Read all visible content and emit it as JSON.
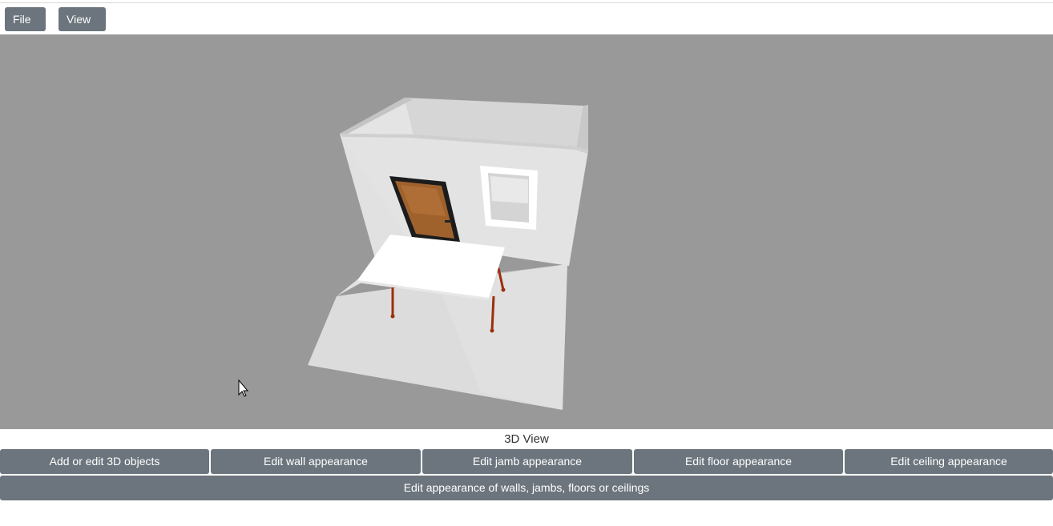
{
  "menubar": {
    "file_label": "File",
    "view_label": "View"
  },
  "viewport": {
    "background": "#999999",
    "caption": "3D View"
  },
  "actions": {
    "row1": [
      "Add or edit 3D objects",
      "Edit wall appearance",
      "Edit jamb appearance",
      "Edit floor appearance",
      "Edit ceiling appearance"
    ],
    "combined": "Edit appearance of walls, jambs, floors or ceilings"
  },
  "colors": {
    "button": "#6c757d",
    "door_wood": "#a0622d",
    "table_legs": "#9c2f0c"
  },
  "scene": {
    "objects": [
      "room-walls",
      "floor",
      "door",
      "window",
      "table"
    ]
  }
}
